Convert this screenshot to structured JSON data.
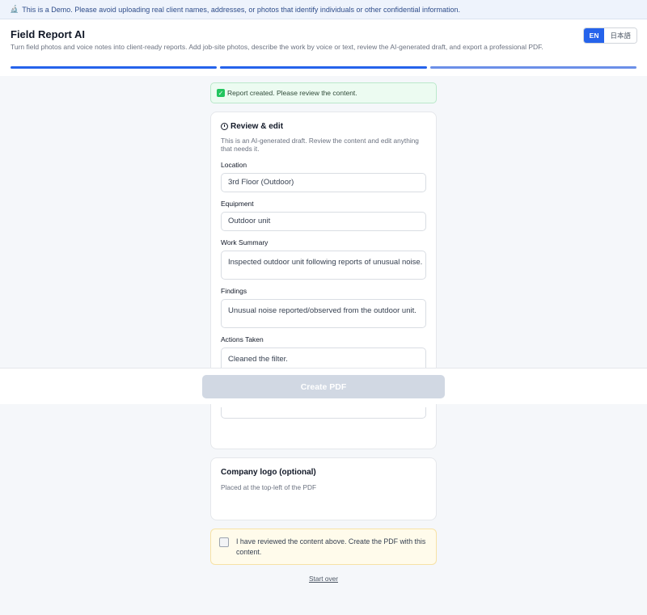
{
  "banner": {
    "icon": "microscope-icon",
    "text": "This is a Demo. Please avoid uploading real client names, addresses, or photos that identify individuals or other confidential information."
  },
  "header": {
    "title": "Field Report AI",
    "subtitle": "Turn field photos and voice notes into client-ready reports. Add job-site photos, describe the work by voice or text, review the AI-generated draft, and export a professional PDF.",
    "lang_en": "EN",
    "lang_ja": "日本語"
  },
  "progress": {
    "total_steps": 3,
    "completed_steps": 3,
    "colors": [
      "#2563eb",
      "#2563eb",
      "#6b8fe8"
    ]
  },
  "status": {
    "icon": "check-icon",
    "message": "Report created. Please review the content."
  },
  "review": {
    "icon": "clock-icon",
    "title": "Review & edit",
    "description": "This is an AI-generated draft. Review the content and edit anything that needs it.",
    "fields": {
      "location": {
        "label": "Location",
        "value": "3rd Floor (Outdoor)"
      },
      "equipment": {
        "label": "Equipment",
        "value": "Outdoor unit"
      },
      "work_summary": {
        "label": "Work Summary",
        "value": "Inspected outdoor unit following reports of unusual noise."
      },
      "findings": {
        "label": "Findings",
        "value": "Unusual noise reported/observed from the outdoor unit."
      },
      "actions_taken": {
        "label": "Actions Taken",
        "value": "Cleaned the filter."
      }
    }
  },
  "logo": {
    "title": "Company logo (optional)",
    "description": "Placed at the top-left of the PDF"
  },
  "confirm": {
    "checked": false,
    "text": "I have reviewed the content above. Create the PDF with this content."
  },
  "start_over": "Start over",
  "footer": {
    "create_pdf": "Create PDF",
    "disabled": true
  }
}
